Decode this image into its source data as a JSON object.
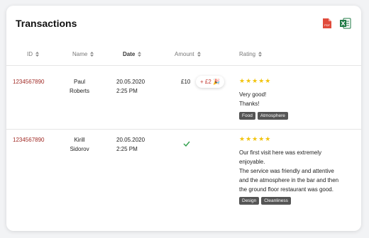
{
  "header": {
    "title": "Transactions",
    "export_pdf_icon": "pdf-export-icon",
    "export_excel_icon": "excel-export-icon",
    "pdf_color": "#e04b3c",
    "excel_color": "#1f7a45"
  },
  "columns": {
    "id": "ID",
    "name": "Name",
    "date": "Date",
    "amount": "Amount",
    "rating": "Rating"
  },
  "rows": [
    {
      "id": "1234567890",
      "first_name": "Paul",
      "last_name": "Roberts",
      "date": "20.05.2020",
      "time": "2:25 PM",
      "amount": "£10",
      "tip": "+ £2 🎉",
      "rating_stars": "★★★★★",
      "comment_lines": [
        "Very good!",
        "Thanks!"
      ],
      "tags": [
        "Food",
        "Atmosphere"
      ]
    },
    {
      "id": "1234567890",
      "first_name": "Kirill",
      "last_name": "Sidorov",
      "date": "20.05.2020",
      "time": "2:25 PM",
      "amount_icon": "check-icon",
      "rating_stars": "★★★★★",
      "comment_lines": [
        "Our first visit here was extremely",
        "enjoyable.",
        "The service was friendly and attentive",
        "and the atmosphere in the bar and then",
        "the ground floor restaurant was good."
      ],
      "tags": [
        "Design",
        "Cleanliness"
      ]
    }
  ],
  "colors": {
    "id_link": "#a12b26",
    "star": "#f2c40f",
    "tag_bg": "#555555",
    "check": "#2e9e4a"
  }
}
